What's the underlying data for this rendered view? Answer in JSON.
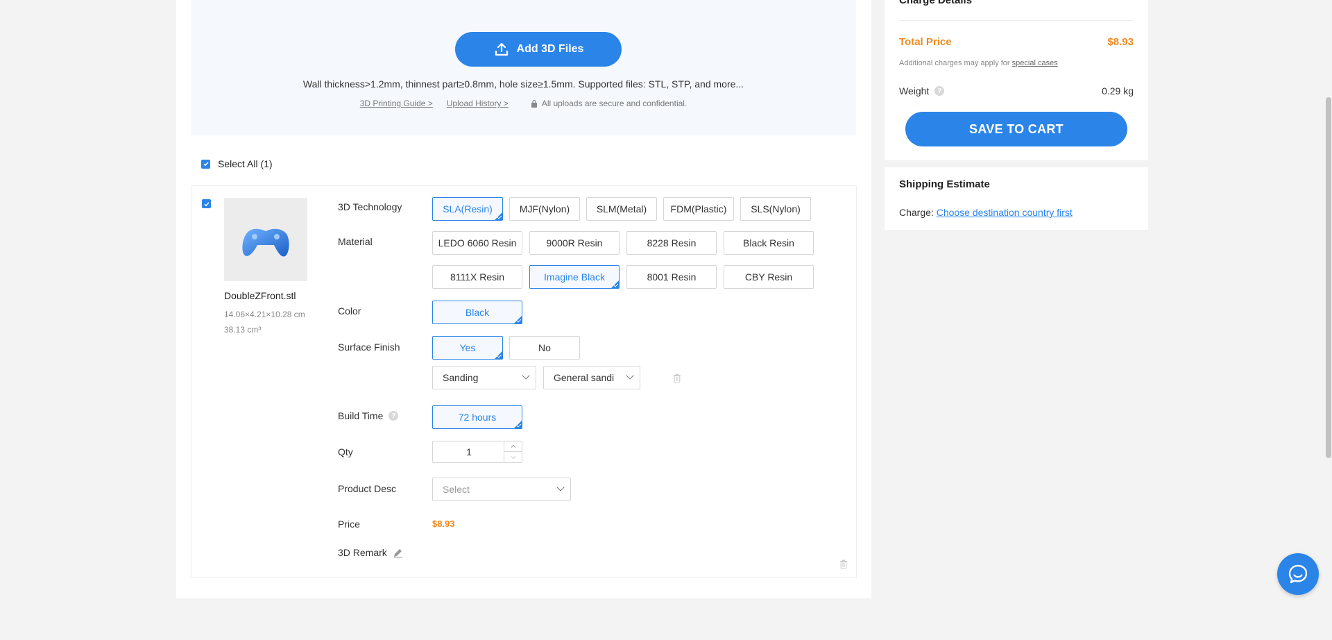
{
  "upload": {
    "add_button": "Add 3D Files",
    "note": "Wall thickness>1.2mm, thinnest part≥0.8mm, hole size≥1.5mm. Supported files: STL, STP, and more...",
    "guide_link": "3D Printing Guide >",
    "history_link": "Upload History >",
    "secure_text": "All uploads are secure and confidential."
  },
  "select_all": "Select All (1)",
  "item": {
    "file_name": "DoubleZFront.stl",
    "dims": "14.06×4.21×10.28 cm",
    "volume": "38.13 cm³",
    "labels": {
      "technology": "3D Technology",
      "material": "Material",
      "color": "Color",
      "surface_finish": "Surface Finish",
      "build_time": "Build Time",
      "qty": "Qty",
      "product_desc": "Product Desc",
      "price": "Price",
      "remark": "3D Remark"
    },
    "technologies": [
      "SLA(Resin)",
      "MJF(Nylon)",
      "SLM(Metal)",
      "FDM(Plastic)",
      "SLS(Nylon)"
    ],
    "materials": [
      "LEDO 6060 Resin",
      "9000R Resin",
      "8228 Resin",
      "Black Resin",
      "8111X Resin",
      "Imagine Black",
      "8001 Resin",
      "CBY Resin"
    ],
    "color": "Black",
    "surface_options": [
      "Yes",
      "No"
    ],
    "finish_type": "Sanding",
    "finish_detail": "General sandi",
    "build_time": "72 hours",
    "qty": "1",
    "product_desc_placeholder": "Select",
    "price": "$8.93"
  },
  "charge": {
    "title": "Charge Details",
    "total_label": "Total Price",
    "total_value": "$8.93",
    "note_prefix": "Additional charges may apply for ",
    "note_link": "special cases",
    "weight_label": "Weight",
    "weight_value": "0.29 kg",
    "save_button": "SAVE TO CART"
  },
  "shipping": {
    "title": "Shipping Estimate",
    "charge_label": "Charge: ",
    "charge_link": "Choose destination country first"
  },
  "colors": {
    "accent": "#2b84e8",
    "price": "#f08a1e"
  }
}
